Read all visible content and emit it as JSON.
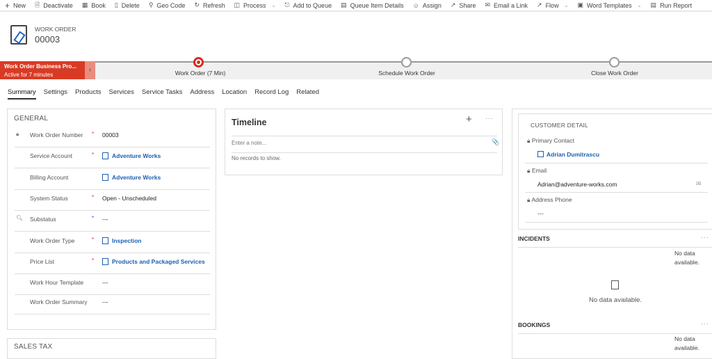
{
  "toolbar": {
    "items": [
      {
        "icon": "plus-icon",
        "label": "New"
      },
      {
        "icon": "deactivate-icon",
        "label": "Deactivate"
      },
      {
        "icon": "calendar-icon",
        "label": "Book"
      },
      {
        "icon": "trash-icon",
        "label": "Delete"
      },
      {
        "icon": "pin-icon",
        "label": "Geo Code"
      },
      {
        "icon": "refresh-icon",
        "label": "Refresh"
      },
      {
        "icon": "process-icon",
        "label": "Process",
        "dropdown": true
      },
      {
        "icon": "queue-icon",
        "label": "Add to Queue"
      },
      {
        "icon": "details-icon",
        "label": "Queue Item Details"
      },
      {
        "icon": "person-icon",
        "label": "Assign"
      },
      {
        "icon": "share-icon",
        "label": "Share"
      },
      {
        "icon": "email-icon",
        "label": "Email a Link"
      },
      {
        "icon": "flow-icon",
        "label": "Flow",
        "dropdown": true
      },
      {
        "icon": "word-icon",
        "label": "Word Templates",
        "dropdown": true
      },
      {
        "icon": "report-icon",
        "label": "Run Report"
      }
    ]
  },
  "header": {
    "entity": "WORK ORDER",
    "record_id": "00003"
  },
  "bpf": {
    "name": "Work Order Business Pro...",
    "active": "Active for 7 minutes",
    "accent": "#d83b25",
    "stages": [
      {
        "label": "Work Order  (7 Min)",
        "active": true
      },
      {
        "label": "Schedule Work Order"
      },
      {
        "label": "Close Work Order"
      }
    ]
  },
  "tabs": [
    "Summary",
    "Settings",
    "Products",
    "Services",
    "Service Tasks",
    "Address",
    "Location",
    "Record Log",
    "Related"
  ],
  "general": {
    "title": "GENERAL",
    "fields": [
      {
        "label": "Work Order Number",
        "required": "*",
        "value": "00003",
        "lock": true
      },
      {
        "label": "Service Account",
        "required": "*",
        "value": "Adventure Works",
        "link": true
      },
      {
        "label": "Billing Account",
        "required": "",
        "value": "Adventure Works",
        "link": true
      },
      {
        "label": "System Status",
        "required": "*",
        "value": "Open - Unscheduled"
      },
      {
        "label": "Substatus",
        "required": "*",
        "value": "---",
        "search": true
      },
      {
        "label": "Work Order Type",
        "required": "*",
        "value": "Inspection",
        "link": true
      },
      {
        "label": "Price List",
        "required": "*",
        "value": "Products and Packaged Services",
        "link": true
      },
      {
        "label": "Work Hour Template",
        "required": "",
        "value": "---"
      },
      {
        "label": "Work Order Summary",
        "required": "",
        "value": "---"
      }
    ]
  },
  "sales_tax": {
    "title": "SALES TAX"
  },
  "timeline": {
    "title": "Timeline",
    "placeholder": "Enter a note...",
    "empty": "No records to show."
  },
  "customer": {
    "title": "CUSTOMER DETAIL",
    "primary_contact_label": "Primary Contact",
    "primary_contact": "Adrian Dumitrascu",
    "email_label": "Email",
    "email": "Adrian@adventure-works.com",
    "phone_label": "Address Phone",
    "phone": "---"
  },
  "incidents": {
    "title": "INCIDENTS",
    "no_data": "No data available.",
    "no_data_center": "No data available."
  },
  "bookings": {
    "title": "BOOKINGS",
    "no_data": "No data available."
  }
}
